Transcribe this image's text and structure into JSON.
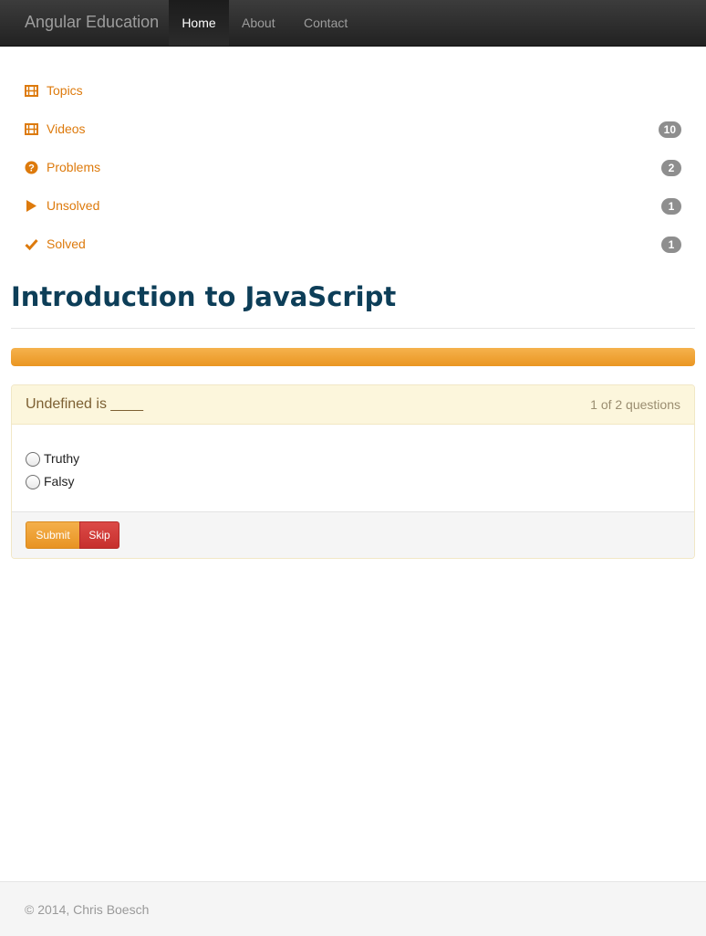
{
  "navbar": {
    "brand": "Angular Education",
    "items": [
      {
        "label": "Home",
        "active": true
      },
      {
        "label": "About",
        "active": false
      },
      {
        "label": "Contact",
        "active": false
      }
    ]
  },
  "sidebar": {
    "items": [
      {
        "label": "Topics",
        "icon": "film-icon",
        "badge": null
      },
      {
        "label": "Videos",
        "icon": "film-icon",
        "badge": "10"
      },
      {
        "label": "Problems",
        "icon": "question-circle-icon",
        "badge": "2"
      },
      {
        "label": "Unsolved",
        "icon": "play-icon",
        "badge": "1"
      },
      {
        "label": "Solved",
        "icon": "checkmark-icon",
        "badge": "1"
      }
    ]
  },
  "page": {
    "title": "Introduction to JavaScript"
  },
  "progress": {
    "value_percent": 100
  },
  "question": {
    "text": "Undefined is ____",
    "counter": "1 of 2 questions",
    "options": [
      {
        "label": "Truthy",
        "selected": false
      },
      {
        "label": "Falsy",
        "selected": false
      }
    ],
    "submit_label": "Submit",
    "skip_label": "Skip"
  },
  "footer": {
    "copyright": "© 2014, Chris Boesch"
  },
  "colors": {
    "accent": "#dd7a0c",
    "title": "#0d3e58",
    "badge": "#8e8e8e",
    "submit": "#ea9622",
    "skip": "#c6302d",
    "navbar": "#222222"
  }
}
